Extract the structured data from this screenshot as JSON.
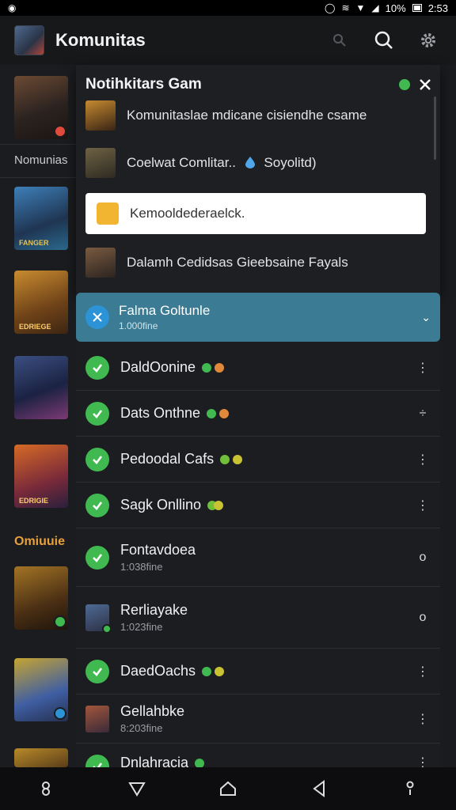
{
  "status_bar": {
    "right_text": "10%",
    "time": "2:53"
  },
  "app_bar": {
    "title": "Komunitas",
    "icons": [
      "small-search-icon",
      "search-icon",
      "gear-icon"
    ]
  },
  "background_list": {
    "section_label_1": "Nomunias",
    "section_label_2": "Omiuuie",
    "thumb_caption_1": "FANGER",
    "thumb_caption_2": "EDRIEGE",
    "thumb_caption_3": "EDRIGIE"
  },
  "notification_panel": {
    "title": "Notihkitars Gam",
    "items": [
      {
        "text": "Komunitaslae mdicane cisiendhe csame"
      },
      {
        "text_before": "Coelwat Comlitar..",
        "text_after": "Soyolitd)"
      },
      {
        "text": "Kemooldederaelck."
      },
      {
        "text": "Dalamh Cedidsas Gieebsaine Fayals"
      }
    ]
  },
  "friends": {
    "header": {
      "title": "Falma Goltunle",
      "subtitle": "1.000fine"
    },
    "rows": [
      {
        "name": "DaldOonine",
        "sub": "",
        "action": "⋮",
        "dots": [
          "#3fb950",
          "#e0893a"
        ]
      },
      {
        "name": "Dats Onthne",
        "sub": "",
        "action": "÷",
        "dots": [
          "#3fb950",
          "#e0893a"
        ]
      },
      {
        "name": "Pedoodal Cafs",
        "sub": "",
        "action": "⋮",
        "dots": [
          "#6fbf3a",
          "#c9c233"
        ]
      },
      {
        "name": "Sagk Onllino",
        "sub": "",
        "action": "⋮",
        "dots": [
          "#6fbf3a",
          "#c9c233"
        ]
      },
      {
        "name": "Fontavdoea",
        "sub": "1:038fine",
        "action": "o",
        "dots": []
      },
      {
        "name": "Rerliayake",
        "sub": "1:023fine",
        "action": "o",
        "dots": []
      },
      {
        "name": "DaedOachs",
        "sub": "",
        "action": "⋮",
        "dots": [
          "#3fb950",
          "#c9c233"
        ]
      },
      {
        "name": "Gellahbke",
        "sub": "8:203fine",
        "action": "⋮",
        "dots": []
      },
      {
        "name": "Dnlahracia",
        "sub": "",
        "action": "⋮",
        "dots": [
          "#3fb950"
        ]
      }
    ]
  },
  "nav_bar": {
    "icons": [
      "recents-icon",
      "back-triangle-icon",
      "home-icon",
      "back-icon",
      "assistant-icon"
    ]
  },
  "colors": {
    "accent": "#3b7b93",
    "online": "#3fb950",
    "background": "#1a1b1e"
  }
}
